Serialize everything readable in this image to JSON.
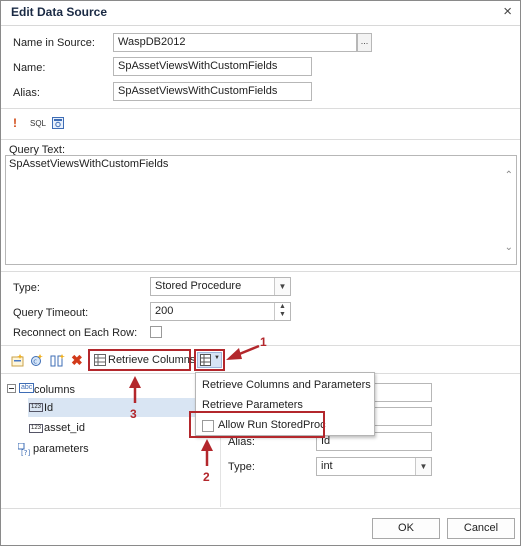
{
  "window": {
    "title": "Edit Data Source",
    "close_glyph": "×"
  },
  "source": {
    "name_in_source_label": "Name in Source:",
    "name_in_source_value": "WaspDB2012",
    "ellipsis": "...",
    "name_label": "Name:",
    "name_value": "SpAssetViewsWithCustomFields",
    "alias_label": "Alias:",
    "alias_value": "SpAssetViewsWithCustomFields"
  },
  "query_toolbar": {
    "exclamation_icon": "!",
    "sql_label": "SQL",
    "query_builder_icon": "query-builder-icon"
  },
  "query": {
    "label": "Query Text:",
    "value": "SpAssetViewsWithCustomFields"
  },
  "settings": {
    "type_label": "Type:",
    "type_value": "Stored Procedure",
    "timeout_label": "Query Timeout:",
    "timeout_value": "200",
    "reconnect_label": "Reconnect on Each Row:"
  },
  "columns_toolbar": {
    "retrieve_columns_label": "Retrieve Columns"
  },
  "tree": {
    "columns_label": "columns",
    "columns_icon_text": "abc",
    "items": [
      {
        "label": "Id",
        "icon": "123"
      },
      {
        "label": "asset_id",
        "icon": "123"
      }
    ],
    "parameters_label": "parameters"
  },
  "dropdown_menu": {
    "items": [
      "Retrieve Columns and Parameters",
      "Retrieve Parameters",
      "Allow Run StoredProc"
    ]
  },
  "properties": {
    "alias_label": "Alias:",
    "alias_value": "Id",
    "type_label": "Type:",
    "type_value": "int"
  },
  "callouts": {
    "one": "1",
    "two": "2",
    "three": "3"
  },
  "colors": {
    "accent_red": "#b3272c",
    "selection": "#d9e5f3"
  },
  "footer": {
    "ok": "OK",
    "cancel": "Cancel"
  }
}
